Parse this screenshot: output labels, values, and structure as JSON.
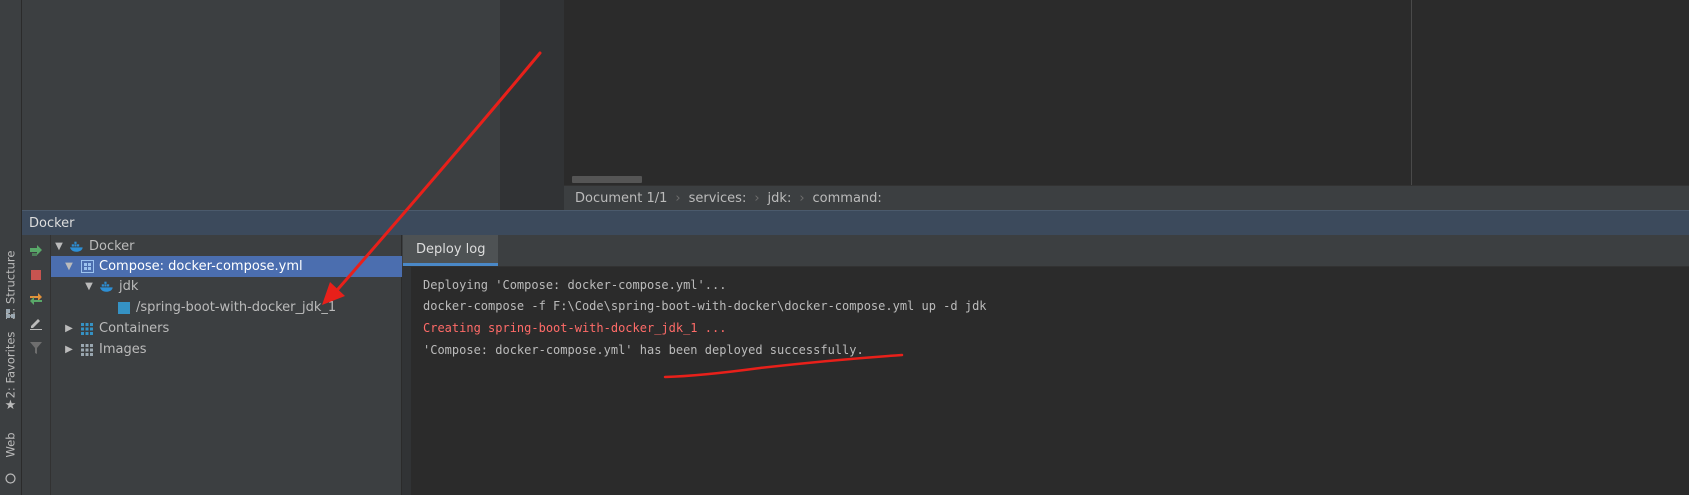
{
  "left_stripe": {
    "tabs": [
      {
        "label": "Z: Structure",
        "icon": "structure-icon"
      },
      {
        "label": "2: Favorites",
        "icon": "star-icon"
      },
      {
        "label": "Web",
        "icon": "web-icon"
      }
    ]
  },
  "breadcrumb": {
    "items": [
      "Document 1/1",
      "services:",
      "jdk:",
      "command:"
    ],
    "separator": "›"
  },
  "tool_window": {
    "title": "Docker"
  },
  "toolbar": {
    "buttons": [
      "deploy-icon",
      "stop-icon",
      "redeploy-icon",
      "edit-icon",
      "filter-icon"
    ]
  },
  "tree": {
    "items": [
      {
        "label": "Docker",
        "expanded": true,
        "icon": "docker-icon"
      },
      {
        "label": "Compose: docker-compose.yml",
        "expanded": true,
        "selected": true,
        "icon": "compose-icon"
      },
      {
        "label": "jdk",
        "expanded": true,
        "icon": "docker-service-icon"
      },
      {
        "label": "/spring-boot-with-docker_jdk_1",
        "icon": "container-icon"
      },
      {
        "label": "Containers",
        "expanded": false,
        "icon": "containers-icon"
      },
      {
        "label": "Images",
        "expanded": false,
        "icon": "images-icon"
      }
    ]
  },
  "log": {
    "tab_label": "Deploy log",
    "lines": [
      {
        "text": "Deploying 'Compose: docker-compose.yml'...",
        "color": "#bbbbbb"
      },
      {
        "text": "docker-compose -f F:\\Code\\spring-boot-with-docker\\docker-compose.yml up -d jdk",
        "color": "#bbbbbb"
      },
      {
        "text": "Creating spring-boot-with-docker_jdk_1 ...",
        "color": "#ff6b68"
      },
      {
        "text": "'Compose: docker-compose.yml' has been deployed successfully.",
        "color": "#bbbbbb"
      }
    ]
  },
  "colors": {
    "selection": "#4b6eaf",
    "annotation": "#e8201a",
    "docker_blue": "#2d8fd5",
    "tab_underline": "#4a88c7"
  }
}
